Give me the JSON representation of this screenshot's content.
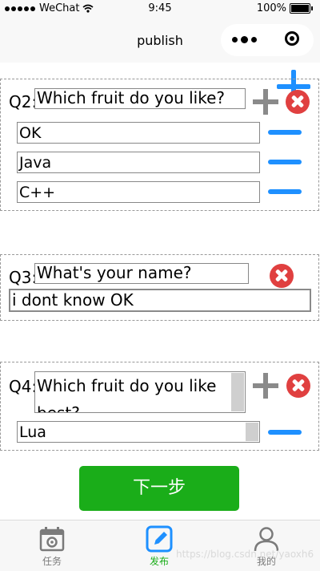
{
  "status_bar": {
    "carrier": "WeChat",
    "time": "9:45",
    "battery": "100%"
  },
  "nav": {
    "title": "publish"
  },
  "questions": [
    {
      "label": "Q2:",
      "text": "Which fruit do you like?",
      "options": [
        "OK",
        "Java",
        "C++"
      ]
    },
    {
      "label": "Q3:",
      "text": "What's your name?",
      "answer": "i dont know OK"
    },
    {
      "label": "Q4:",
      "text": "Which fruit do you like best?",
      "options": [
        "Lua"
      ]
    }
  ],
  "next_button": "下一步",
  "tabs": [
    {
      "label": "任务",
      "icon": "calendar-gear-icon"
    },
    {
      "label": "发布",
      "icon": "edit-icon",
      "active": true
    },
    {
      "label": "我的",
      "icon": "user-icon"
    }
  ],
  "watermark": "https://blog.csdn.net/yaoxh6",
  "colors": {
    "accent_blue": "#1e90ff",
    "primary_green": "#1aad19",
    "delete_red": "#e04040"
  }
}
